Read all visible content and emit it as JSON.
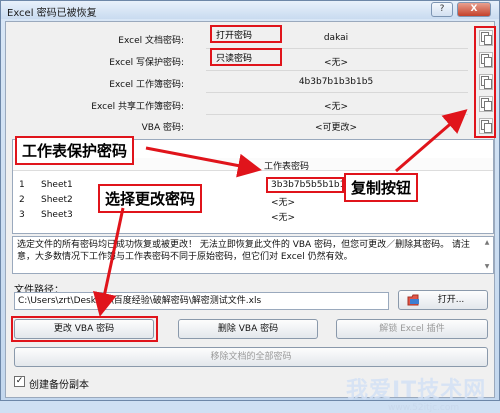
{
  "window": {
    "title": "Excel 密码已被恢复",
    "help_label": "?",
    "close_label": "X"
  },
  "fields": [
    {
      "label": "Excel 文档密码:",
      "value": "dakai"
    },
    {
      "label": "Excel 写保护密码:",
      "value": "<无>"
    },
    {
      "label": "Excel 工作簿密码:",
      "value": "4b3b7b1b3b1b5"
    },
    {
      "label": "Excel 共享工作簿密码:",
      "value": "<无>"
    },
    {
      "label": "VBA 密码:",
      "value": "<可更改>"
    }
  ],
  "annotations": {
    "open_password": "打开密码",
    "readonly_password": "只读密码",
    "sheet_protect_password": "工作表保护密码",
    "copy_button": "复制按钮",
    "choose_change_password": "选择更改密码"
  },
  "table": {
    "header": "工作表密码",
    "rows": [
      {
        "num": "1",
        "name": "Sheet1",
        "password": "3b3b7b5b5b1b1"
      },
      {
        "num": "2",
        "name": "Sheet2",
        "password": "<无>"
      },
      {
        "num": "3",
        "name": "Sheet3",
        "password": "<无>"
      }
    ]
  },
  "description": "选定文件的所有密码均已成功恢复或被更改！ 无法立即恢复此文件的 VBA 密码，但您可更改／删除其密码。 请注意，大多数情况下工作簿与工作表密码不同于原始密码，但它们对 Excel 仍然有效。",
  "file_path": {
    "label": "文件路径：",
    "value": "C:\\Users\\zrt\\Desktop\\百度经验\\破解密码\\解密测试文件.xls"
  },
  "buttons": {
    "open": "打开...",
    "change_vba": "更改 VBA 密码",
    "delete_vba": "删除 VBA 密码",
    "unlock_excel": "解锁 Excel 插件",
    "remove_all": "移除文档的全部密码"
  },
  "backup": {
    "label": "创建备份副本",
    "checked": true,
    "mark": "✓"
  },
  "watermark": {
    "main": "我爱IT技术网",
    "sub": "www.52itjc.com"
  },
  "colors": {
    "annotation_red": "#e0141b"
  }
}
